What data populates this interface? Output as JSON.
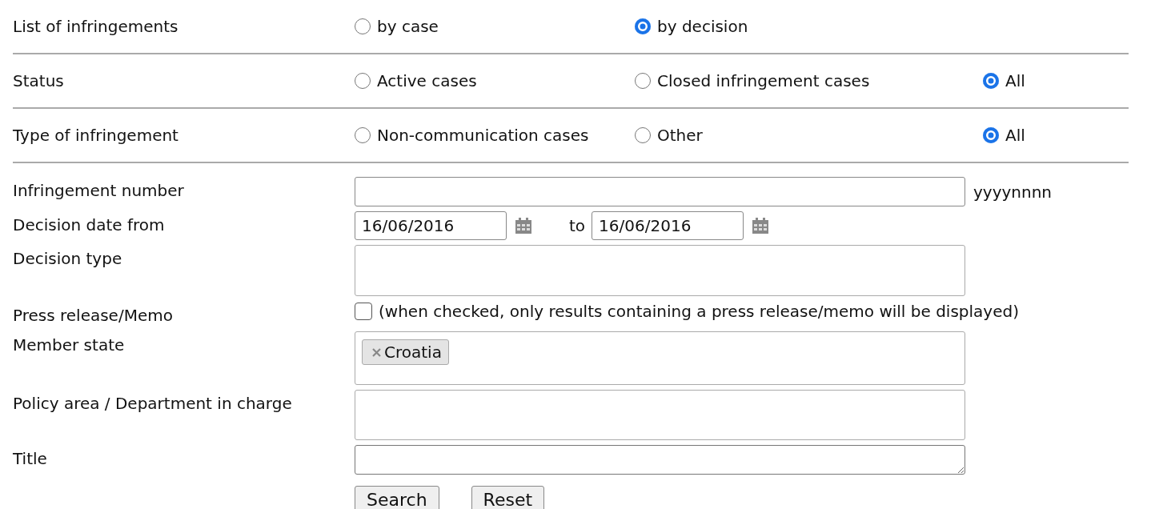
{
  "filters": [
    {
      "label": "List of infringements",
      "options": [
        {
          "label": "by case",
          "selected": false
        },
        {
          "label": "by decision",
          "selected": true
        }
      ]
    },
    {
      "label": "Status",
      "options": [
        {
          "label": "Active cases",
          "selected": false
        },
        {
          "label": "Closed infringement cases",
          "selected": false
        },
        {
          "label": "All",
          "selected": true
        }
      ]
    },
    {
      "label": "Type of infringement",
      "options": [
        {
          "label": "Non-communication cases",
          "selected": false
        },
        {
          "label": "Other",
          "selected": false
        },
        {
          "label": "All",
          "selected": true
        }
      ]
    }
  ],
  "fields": [
    {
      "kind": "text",
      "label": "Infringement number",
      "hint": "yyyynnnn"
    },
    {
      "kind": "daterange",
      "label": "Decision date from",
      "from": "16/06/2016",
      "to_label": "to",
      "to": "16/06/2016"
    },
    {
      "kind": "multiselect",
      "label": "Decision type"
    },
    {
      "kind": "checkbox",
      "label": "Press release/Memo",
      "checked": false,
      "note": "(when checked, only results containing a press release/memo will be displayed)"
    },
    {
      "kind": "multiselect",
      "label": "Member state",
      "tags": [
        "Croatia"
      ]
    },
    {
      "kind": "multiselect",
      "label": "Policy area / Department in charge"
    },
    {
      "kind": "textarea",
      "label": "Title"
    }
  ],
  "buttons": [
    "Search",
    "Reset"
  ]
}
